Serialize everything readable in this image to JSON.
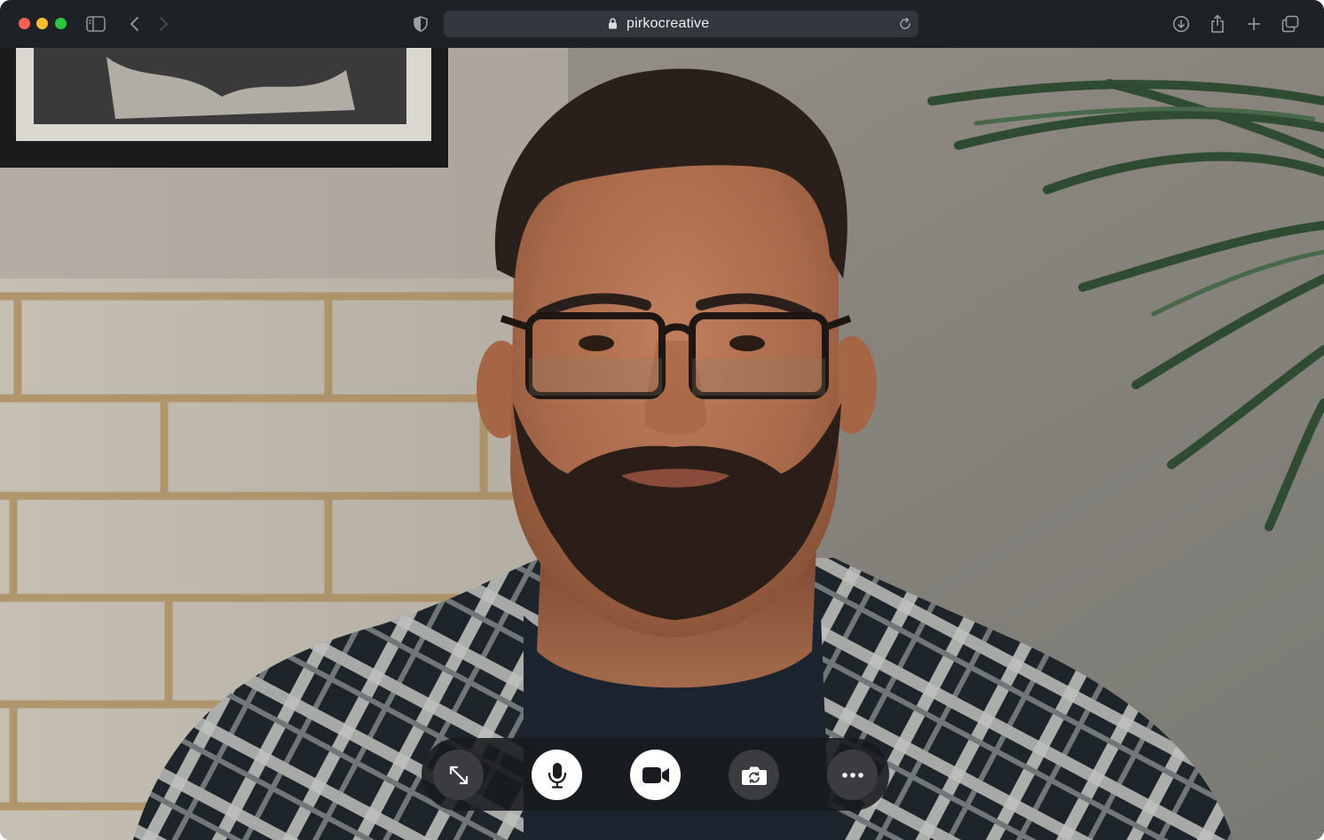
{
  "browser": {
    "url": "pirkocreative",
    "icons": [
      "sidebar-icon",
      "back-icon",
      "forward-icon",
      "shield-icon",
      "lock-icon",
      "reload-icon",
      "download-icon",
      "share-icon",
      "new-tab-icon",
      "tabs-overview-icon"
    ]
  },
  "video": {
    "description_colors": {
      "shirt_dark": "#1c2226",
      "shirt_light": "#e6e6e2",
      "skin": "#b67452"
    }
  },
  "call_controls": {
    "buttons": [
      {
        "name": "fullscreen",
        "icon": "expand-icon",
        "style": "dark"
      },
      {
        "name": "microphone",
        "icon": "microphone-icon",
        "style": "light"
      },
      {
        "name": "camera",
        "icon": "video-camera-icon",
        "style": "light"
      },
      {
        "name": "switch-camera",
        "icon": "camera-switch-icon",
        "style": "dark"
      },
      {
        "name": "more",
        "icon": "more-icon",
        "style": "dark"
      }
    ]
  }
}
